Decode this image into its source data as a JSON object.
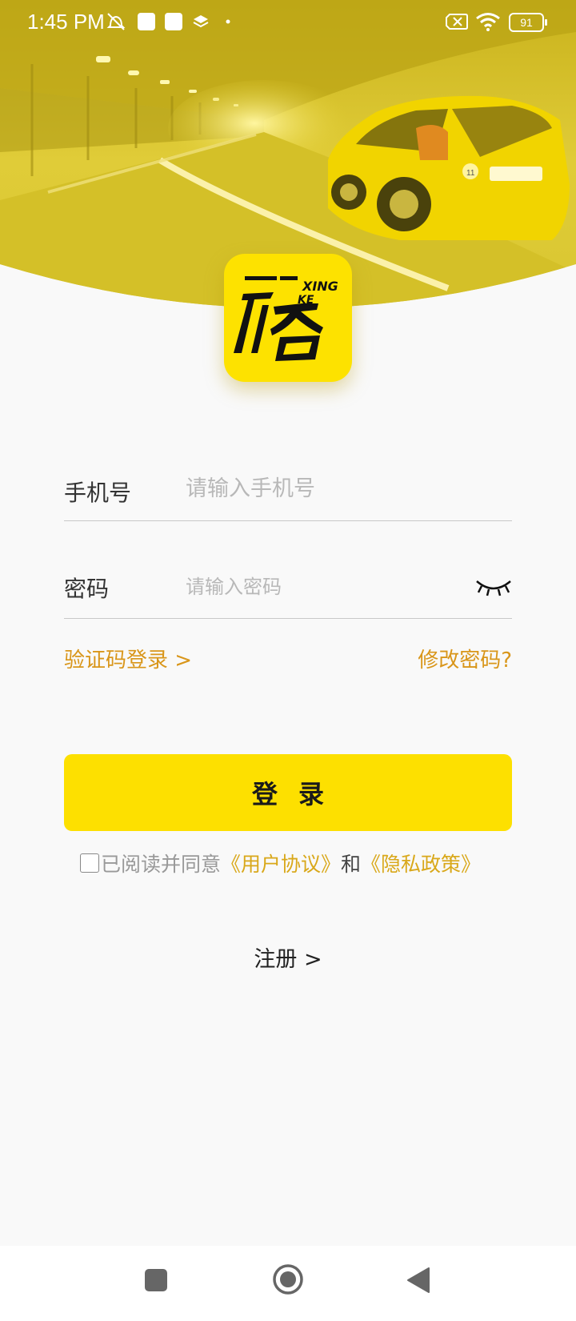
{
  "status_bar": {
    "time": "1:45 PM",
    "battery_level": "91",
    "icons": [
      "mute-icon",
      "square-icon",
      "square-icon",
      "layers-icon",
      "dot-icon",
      "sim-x-icon",
      "wifi-icon",
      "battery-icon"
    ]
  },
  "logo": {
    "text_top": "XING",
    "text_bottom": "KE"
  },
  "form": {
    "phone_label": "手机号",
    "phone_placeholder": "请输入手机号",
    "password_label": "密码",
    "password_placeholder": "请输入密码"
  },
  "links": {
    "sms_login": "验证码登录 >",
    "change_password": "修改密码?"
  },
  "login_button_label": "登录",
  "agreement": {
    "prefix": "已阅读并同意",
    "user_agreement": "《用户协议》",
    "and": "和",
    "privacy_policy": "《隐私政策》",
    "checked": false
  },
  "register_label": "注册 >",
  "nav_bar": {
    "buttons": [
      "recents-button",
      "home-button",
      "back-button"
    ]
  },
  "colors": {
    "brand_yellow": "#fde000",
    "link_orange": "#d9961a",
    "agreement_link": "#d9a81a",
    "background": "#f9f9f9"
  }
}
